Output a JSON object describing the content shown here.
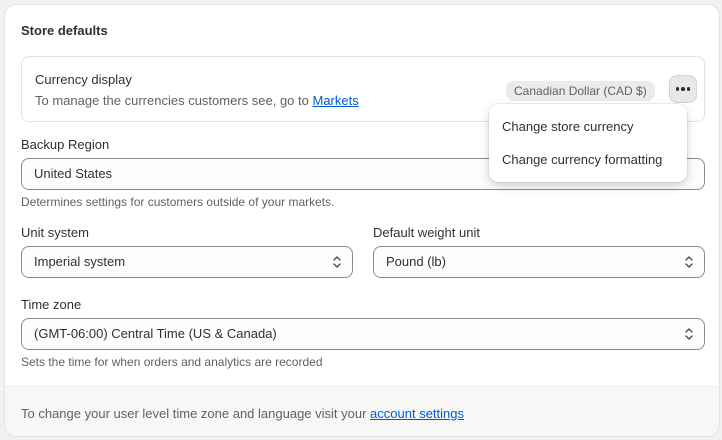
{
  "section": {
    "title": "Store defaults"
  },
  "currency": {
    "label": "Currency display",
    "description": "To manage the currencies customers see, go to ",
    "link": "Markets",
    "badge": "Canadian Dollar (CAD $)",
    "more_icon": "ellipsis-horizontal-icon"
  },
  "menu": {
    "items": [
      "Change store currency",
      "Change currency formatting"
    ]
  },
  "backup_region": {
    "label": "Backup Region",
    "value": "United States",
    "help": "Determines settings for customers outside of your markets."
  },
  "unit_system": {
    "label": "Unit system",
    "value": "Imperial system"
  },
  "weight_unit": {
    "label": "Default weight unit",
    "value": "Pound (lb)"
  },
  "time_zone": {
    "label": "Time zone",
    "value": "(GMT-06:00) Central Time (US & Canada)",
    "help": "Sets the time for when orders and analytics are recorded"
  },
  "footer": {
    "text": "To change your user level time zone and language visit your ",
    "link": "account settings"
  },
  "colors": {
    "link": "#005bd3",
    "border": "#8a8a8a",
    "text": "#303030"
  }
}
